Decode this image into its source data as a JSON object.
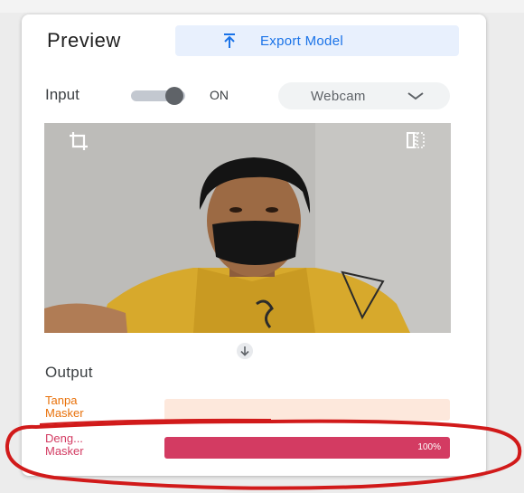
{
  "header": {
    "title": "Preview",
    "export_label": "Export Model",
    "export_icon": "upload-icon"
  },
  "input": {
    "label": "Input",
    "toggle_state": "ON",
    "source": "Webcam"
  },
  "preview": {
    "crop_icon": "crop-icon",
    "flip_icon": "flip-camera-icon"
  },
  "output": {
    "label": "Output",
    "classes": [
      {
        "name_line1": "Tanpa",
        "name_line2": "Masker",
        "confidence": 0,
        "percent_text": "",
        "color": "#e8710a",
        "track_color": "#fde8dc"
      },
      {
        "name_line1": "Deng...",
        "name_line2": "Masker",
        "confidence": 1.0,
        "percent_text": "100%",
        "color": "#d33b62",
        "track_color": "#fbe3e8"
      }
    ]
  },
  "colors": {
    "accent": "#1a73e8",
    "annotation": "#d11a1a"
  }
}
